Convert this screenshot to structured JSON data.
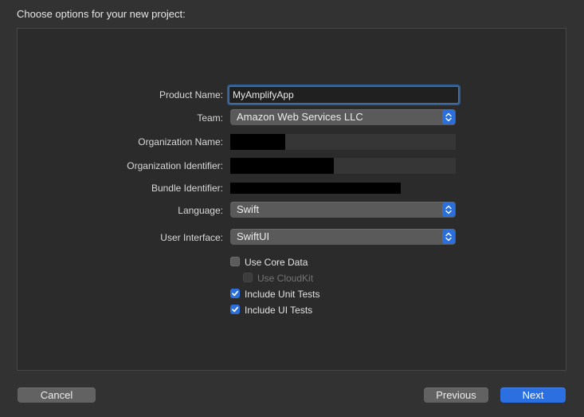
{
  "sheet": {
    "title": "Choose options for your new project:"
  },
  "form": {
    "product_name": {
      "label": "Product Name:",
      "value": "MyAmplifyApp"
    },
    "team": {
      "label": "Team:",
      "value": "Amazon Web Services LLC"
    },
    "organization_name": {
      "label": "Organization Name:"
    },
    "organization_identifier": {
      "label": "Organization Identifier:"
    },
    "bundle_identifier": {
      "label": "Bundle Identifier:"
    },
    "language": {
      "label": "Language:",
      "value": "Swift"
    },
    "user_interface": {
      "label": "User Interface:",
      "value": "SwiftUI"
    }
  },
  "options": [
    {
      "label": "Use Core Data",
      "checked": false,
      "enabled": true
    },
    {
      "label": "Use CloudKit",
      "checked": false,
      "enabled": false
    },
    {
      "label": "Include Unit Tests",
      "checked": true,
      "enabled": true
    },
    {
      "label": "Include UI Tests",
      "checked": true,
      "enabled": true
    }
  ],
  "footer": {
    "cancel_label": "Cancel",
    "previous_label": "Previous",
    "next_label": "Next"
  },
  "colors": {
    "accent": "#2b6fe0",
    "background": "#323232",
    "panel": "#2b2b2b"
  },
  "icons": {
    "popup_indicator": "chevron-up-down-icon",
    "checkmark": "checkmark-icon"
  }
}
